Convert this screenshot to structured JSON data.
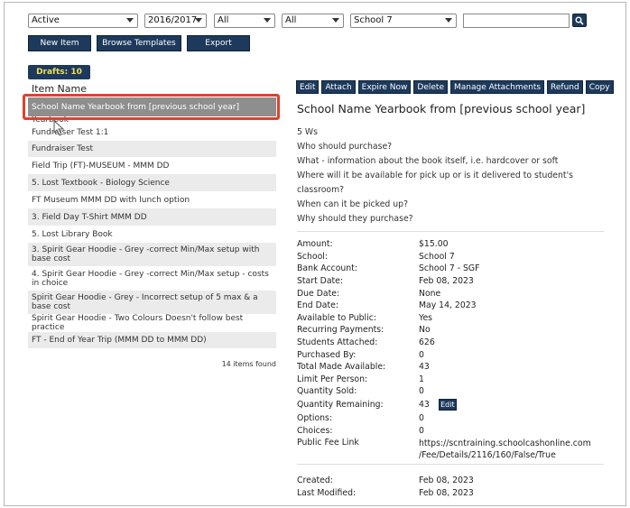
{
  "filters": {
    "status": "Active",
    "year": "2016/2017",
    "filter1": "All",
    "filter2": "All",
    "school": "School 7",
    "search_value": ""
  },
  "toolbar": {
    "new_item": "New Item",
    "browse_templates": "Browse Templates",
    "export": "Export"
  },
  "drafts_label": "Drafts: 10",
  "list_header": "Item Name",
  "items": [
    "School Name Yearbook from [previous school year]",
    "Yearbook",
    "Fundraiser Test 1:1",
    "Fundraiser Test",
    "Field Trip (FT)-MUSEUM - MMM DD",
    "5. Lost Textbook - Biology Science",
    "FT Museum MMM DD with lunch option",
    "3. Field Day T-Shirt MMM DD",
    "5. Lost Library Book",
    "3. Spirit Gear Hoodie - Grey -correct Min/Max setup with base cost",
    "4. Spirit Gear Hoodie - Grey -correct Min/Max setup - costs in choice",
    "Spirit Gear Hoodie - Grey - Incorrect setup of 5 max & a base cost",
    "Spirit Gear Hoodie - Two Colours Doesn't follow best practice",
    "FT - End of Year Trip (MMM DD to MMM DD)"
  ],
  "items_found": "14 items found",
  "actions": [
    "Edit",
    "Attach",
    "Expire Now",
    "Delete",
    "Manage Attachments",
    "Refund",
    "Copy"
  ],
  "detail": {
    "title": "School Name Yearbook from [previous school year]",
    "description": [
      "5 Ws",
      "Who should purchase?",
      "What - information about the book itself, i.e. hardcover or soft",
      "Where will it be available for pick up or is it delivered to student's",
      "classroom?",
      "When can it be picked up?",
      "Why should they purchase?"
    ],
    "fields": [
      {
        "k": "Amount:",
        "v": "$15.00"
      },
      {
        "k": "School:",
        "v": "School 7"
      },
      {
        "k": "Bank Account:",
        "v": "School 7 - SGF"
      },
      {
        "k": "Start Date:",
        "v": "Feb 08, 2023"
      },
      {
        "k": "Due Date:",
        "v": "None"
      },
      {
        "k": "End Date:",
        "v": "May 14, 2023"
      },
      {
        "k": "Available to Public:",
        "v": "Yes"
      },
      {
        "k": "Recurring Payments:",
        "v": "No"
      },
      {
        "k": "Students Attached:",
        "v": "626"
      },
      {
        "k": "Purchased By:",
        "v": "0"
      },
      {
        "k": "Total Made Available:",
        "v": "43"
      },
      {
        "k": "Limit Per Person:",
        "v": "1"
      },
      {
        "k": "Quantity Sold:",
        "v": "0"
      },
      {
        "k": "Quantity Remaining:",
        "v": "43"
      },
      {
        "k": "Options:",
        "v": "0"
      },
      {
        "k": "Choices:",
        "v": "0"
      }
    ],
    "remaining_edit": "Edit",
    "public_link_label": "Public Fee Link",
    "public_link_line1": "https://scntraining.schoolcashonline.com",
    "public_link_line2": "/Fee/Details/2116/160/False/True",
    "created_label": "Created:",
    "created_value": "Feb 08, 2023",
    "modified_label": "Last Modified:",
    "modified_value": "Feb 08, 2023"
  }
}
